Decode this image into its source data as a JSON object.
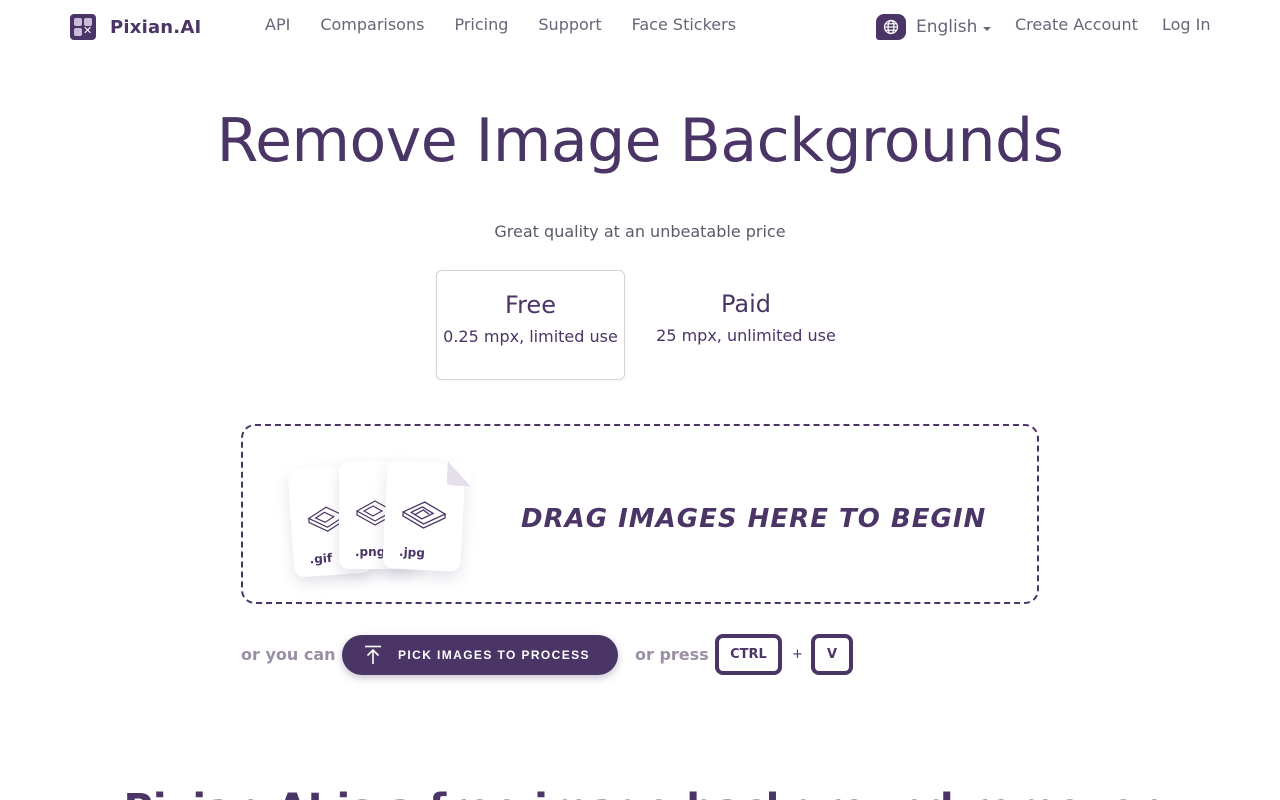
{
  "brand": {
    "name": "Pixian.AI",
    "color": "#4a3566"
  },
  "nav": {
    "items": [
      "API",
      "Comparisons",
      "Pricing",
      "Support",
      "Face Stickers"
    ]
  },
  "header": {
    "language": "English",
    "create_account": "Create Account",
    "log_in": "Log In"
  },
  "hero": {
    "title": "Remove Image Backgrounds",
    "subtitle": "Great quality at an unbeatable price"
  },
  "plans": [
    {
      "name": "Free",
      "desc": "0.25 mpx, limited use"
    },
    {
      "name": "Paid",
      "desc": "25 mpx, unlimited use"
    }
  ],
  "dropzone": {
    "text": "DRAG IMAGES HERE TO BEGIN",
    "files": [
      ".gif",
      ".png",
      ".jpg"
    ]
  },
  "pick_row": {
    "or_you_can": "or you can",
    "pick_label": "PICK IMAGES TO PROCESS",
    "or_press": "or press",
    "key_ctrl": "CTRL",
    "plus": "+",
    "key_v": "V"
  },
  "next_section": {
    "title": "Pixian.AI is a free image background remover"
  }
}
